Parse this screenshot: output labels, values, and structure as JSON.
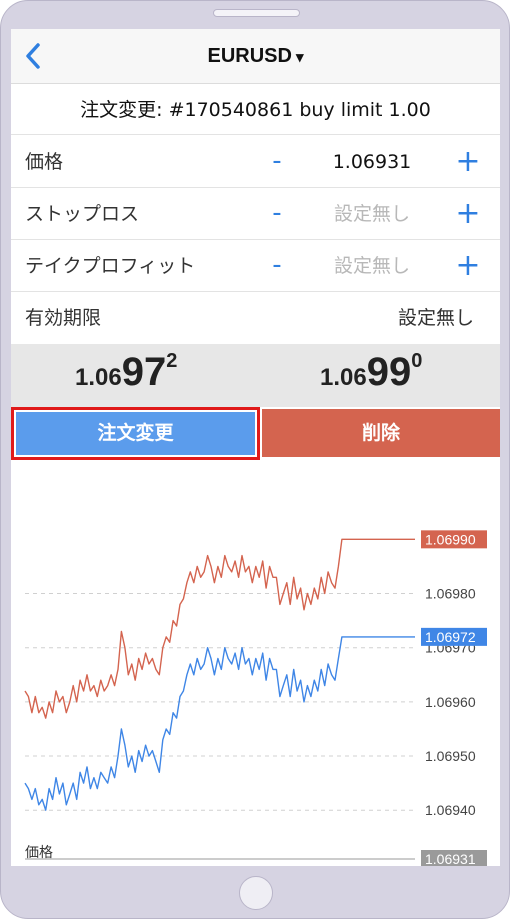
{
  "header": {
    "symbol": "EURUSD",
    "caret": "▾"
  },
  "order": {
    "title": "注文変更: #170540861 buy limit 1.00"
  },
  "fields": {
    "price": {
      "label": "価格",
      "minus": "-",
      "value": "1.06931",
      "plus": "+"
    },
    "stop_loss": {
      "label": "ストップロス",
      "minus": "-",
      "value": "設定無し",
      "plus": "+"
    },
    "take_profit": {
      "label": "テイクプロフィット",
      "minus": "-",
      "value": "設定無し",
      "plus": "+"
    },
    "expiry": {
      "label": "有効期限",
      "value": "設定無し"
    }
  },
  "quotes": {
    "bid": {
      "prefix": "1.06",
      "big": "97",
      "sup": "2"
    },
    "ask": {
      "prefix": "1.06",
      "big": "99",
      "sup": "0"
    }
  },
  "buttons": {
    "modify": "注文変更",
    "delete": "削除"
  },
  "chart_data": {
    "type": "line",
    "xlabel": "価格",
    "ylim": [
      1.06931,
      1.06998
    ],
    "yticks": [
      1.0694,
      1.0695,
      1.0696,
      1.0697,
      1.0698
    ],
    "tick_labels": [
      "1.06940",
      "1.06950",
      "1.06960",
      "1.06970",
      "1.06980"
    ],
    "price_tags": {
      "ask": "1.06990",
      "bid": "1.06972",
      "order": "1.06931"
    },
    "colors": {
      "ask": "#d4644f",
      "bid": "#3f86e6",
      "order": "#9a9a9a"
    },
    "series": [
      {
        "color": "#d4644f",
        "values": [
          1.06962,
          1.06961,
          1.06958,
          1.06961,
          1.06958,
          1.06959,
          1.06957,
          1.0696,
          1.06958,
          1.06962,
          1.0696,
          1.06961,
          1.06958,
          1.0696,
          1.06963,
          1.0696,
          1.06964,
          1.06962,
          1.06965,
          1.06962,
          1.06963,
          1.06961,
          1.06964,
          1.06962,
          1.06963,
          1.06965,
          1.06963,
          1.06966,
          1.06973,
          1.0697,
          1.06965,
          1.06967,
          1.06964,
          1.06968,
          1.06966,
          1.06969,
          1.06967,
          1.06968,
          1.06966,
          1.06965,
          1.0697,
          1.06972,
          1.06971,
          1.06975,
          1.06974,
          1.06978,
          1.06979,
          1.06982,
          1.06984,
          1.06982,
          1.06985,
          1.06983,
          1.06984,
          1.06987,
          1.06985,
          1.06982,
          1.06985,
          1.06983,
          1.06987,
          1.06985,
          1.06984,
          1.06986,
          1.06983,
          1.06987,
          1.06984,
          1.06985,
          1.06982,
          1.06985,
          1.06983,
          1.06986,
          1.06981,
          1.06985,
          1.06983,
          1.06983,
          1.06978,
          1.0698,
          1.06982,
          1.06978,
          1.06983,
          1.06979,
          1.06981,
          1.06977,
          1.0698,
          1.06978,
          1.06981,
          1.06979,
          1.06983,
          1.0698,
          1.06984,
          1.06982,
          1.06981,
          1.06985,
          1.0699,
          1.0699,
          1.0699,
          1.0699,
          1.0699,
          1.0699,
          1.0699,
          1.0699
        ]
      },
      {
        "color": "#3f86e6",
        "values": [
          1.06945,
          1.06944,
          1.06942,
          1.06944,
          1.06941,
          1.06942,
          1.0694,
          1.06944,
          1.06942,
          1.06946,
          1.06943,
          1.06945,
          1.06941,
          1.06943,
          1.06945,
          1.06942,
          1.06947,
          1.06945,
          1.06948,
          1.06944,
          1.06946,
          1.06944,
          1.06947,
          1.06946,
          1.06945,
          1.06948,
          1.06946,
          1.0695,
          1.06955,
          1.06952,
          1.06948,
          1.0695,
          1.06947,
          1.06951,
          1.06949,
          1.06952,
          1.0695,
          1.06951,
          1.06949,
          1.06947,
          1.06953,
          1.06955,
          1.06954,
          1.06958,
          1.06957,
          1.06961,
          1.06962,
          1.06965,
          1.06967,
          1.06965,
          1.06968,
          1.06966,
          1.06967,
          1.0697,
          1.06968,
          1.06965,
          1.06968,
          1.06966,
          1.0697,
          1.06968,
          1.06967,
          1.06969,
          1.06966,
          1.0697,
          1.06967,
          1.06968,
          1.06965,
          1.06968,
          1.06966,
          1.06969,
          1.06964,
          1.06968,
          1.06966,
          1.06966,
          1.06961,
          1.06963,
          1.06965,
          1.06961,
          1.06966,
          1.06962,
          1.06964,
          1.0696,
          1.06963,
          1.06961,
          1.06964,
          1.06962,
          1.06966,
          1.06963,
          1.06967,
          1.06965,
          1.06964,
          1.06968,
          1.06972,
          1.06972,
          1.06972,
          1.06972,
          1.06972,
          1.06972,
          1.06972,
          1.06972
        ]
      }
    ]
  }
}
